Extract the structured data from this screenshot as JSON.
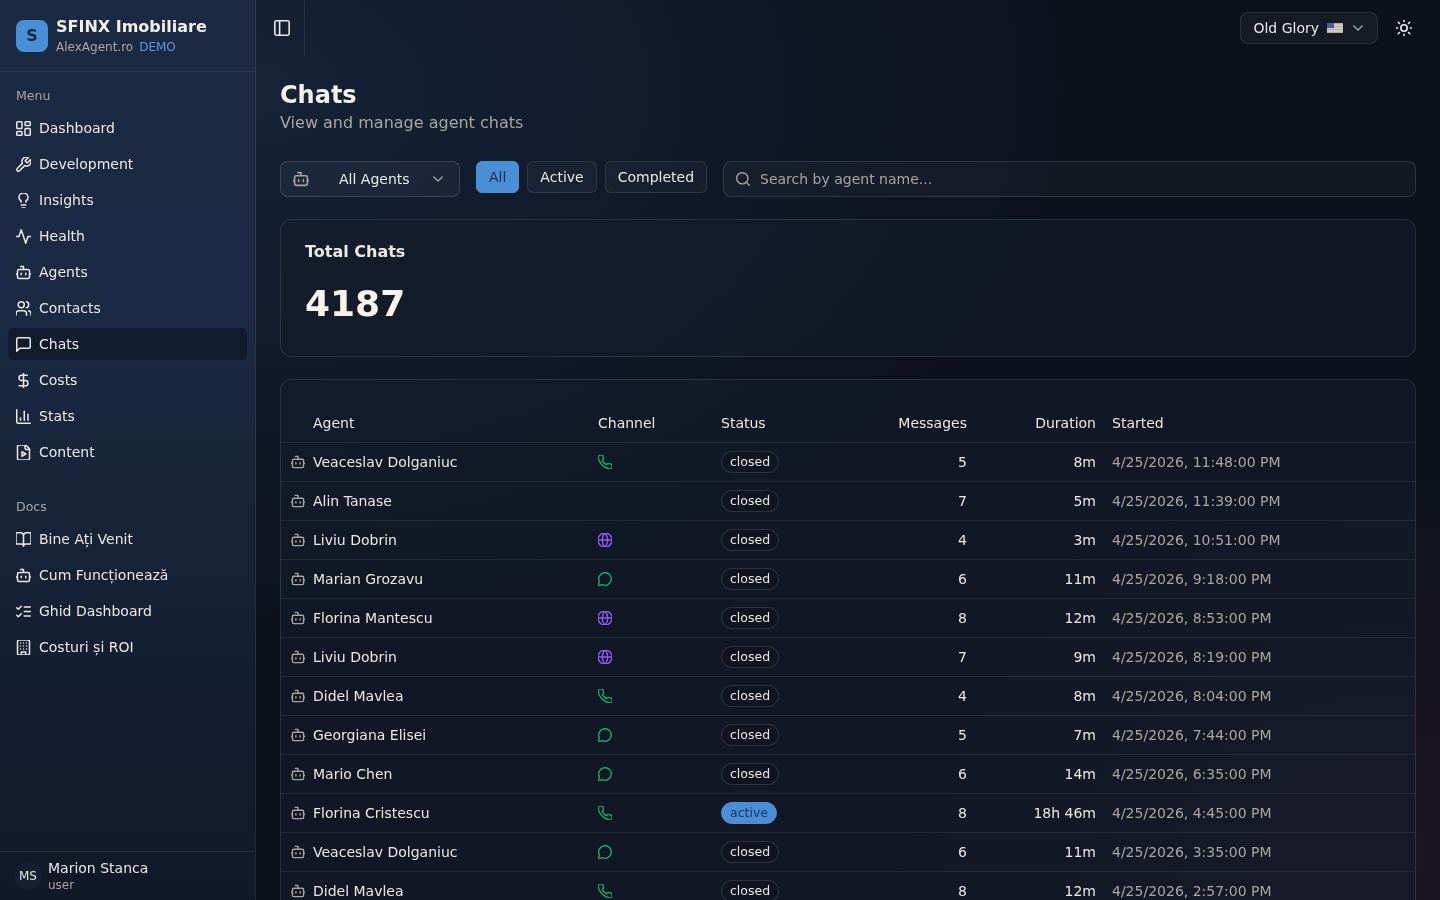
{
  "sidebar": {
    "brand": {
      "logo_letter": "S",
      "name": "SFINX Imobiliare",
      "site": "AlexAgent.ro",
      "badge": "DEMO"
    },
    "sections": [
      {
        "title": "Menu",
        "items": [
          {
            "label": "Dashboard",
            "selected": false
          },
          {
            "label": "Development",
            "selected": false
          },
          {
            "label": "Insights",
            "selected": false
          },
          {
            "label": "Health",
            "selected": false
          },
          {
            "label": "Agents",
            "selected": false
          },
          {
            "label": "Contacts",
            "selected": false
          },
          {
            "label": "Chats",
            "selected": true
          },
          {
            "label": "Costs",
            "selected": false
          },
          {
            "label": "Stats",
            "selected": false
          },
          {
            "label": "Content",
            "selected": false
          }
        ]
      },
      {
        "title": "Docs",
        "items": [
          {
            "label": "Bine Ați Venit",
            "selected": false
          },
          {
            "label": "Cum Funcționează",
            "selected": false
          },
          {
            "label": "Ghid Dashboard",
            "selected": false
          },
          {
            "label": "Costuri și ROI",
            "selected": false
          }
        ]
      }
    ],
    "user": {
      "initials": "MS",
      "name": "Marion Stanca",
      "role": "user"
    }
  },
  "topbar": {
    "theme_select": {
      "value": "Old Glory"
    }
  },
  "page": {
    "title": "Chats",
    "subtitle": "View and manage agent chats"
  },
  "filters": {
    "agent_select": {
      "value": "All Agents"
    },
    "status_tabs": [
      {
        "label": "All",
        "selected": true
      },
      {
        "label": "Active",
        "selected": false
      },
      {
        "label": "Completed",
        "selected": false
      }
    ],
    "search": {
      "placeholder": "Search by agent name..."
    }
  },
  "stats_card": {
    "title": "Total Chats",
    "value": "4187"
  },
  "table": {
    "columns": [
      "Agent",
      "Channel",
      "Status",
      "Messages",
      "Duration",
      "Started"
    ],
    "rows": [
      {
        "agent": "Veaceslav Dolganiuc",
        "channel": {
          "kind": "phone"
        },
        "status": "closed",
        "status_active": false,
        "messages": "5",
        "duration": "8m",
        "started": "4/25/2026, 11:48:00 PM"
      },
      {
        "agent": "Alin Tanase",
        "status": "closed",
        "status_active": false,
        "messages": "7",
        "duration": "5m",
        "started": "4/25/2026, 11:39:00 PM"
      },
      {
        "agent": "Liviu Dobrin",
        "channel": {
          "kind": "web"
        },
        "status": "closed",
        "status_active": false,
        "messages": "4",
        "duration": "3m",
        "started": "4/25/2026, 10:51:00 PM"
      },
      {
        "agent": "Marian Grozavu",
        "channel": {
          "kind": "chat"
        },
        "status": "closed",
        "status_active": false,
        "messages": "6",
        "duration": "11m",
        "started": "4/25/2026, 9:18:00 PM"
      },
      {
        "agent": "Florina Mantescu",
        "channel": {
          "kind": "web"
        },
        "status": "closed",
        "status_active": false,
        "messages": "8",
        "duration": "12m",
        "started": "4/25/2026, 8:53:00 PM"
      },
      {
        "agent": "Liviu Dobrin",
        "channel": {
          "kind": "web"
        },
        "status": "closed",
        "status_active": false,
        "messages": "7",
        "duration": "9m",
        "started": "4/25/2026, 8:19:00 PM"
      },
      {
        "agent": "Didel Mavlea",
        "channel": {
          "kind": "phone"
        },
        "status": "closed",
        "status_active": false,
        "messages": "4",
        "duration": "8m",
        "started": "4/25/2026, 8:04:00 PM"
      },
      {
        "agent": "Georgiana Elisei",
        "channel": {
          "kind": "chat"
        },
        "status": "closed",
        "status_active": false,
        "messages": "5",
        "duration": "7m",
        "started": "4/25/2026, 7:44:00 PM"
      },
      {
        "agent": "Mario Chen",
        "channel": {
          "kind": "chat"
        },
        "status": "closed",
        "status_active": false,
        "messages": "6",
        "duration": "14m",
        "started": "4/25/2026, 6:35:00 PM"
      },
      {
        "agent": "Florina Cristescu",
        "channel": {
          "kind": "phone"
        },
        "status": "active",
        "status_active": true,
        "messages": "8",
        "duration": "18h 46m",
        "started": "4/25/2026, 4:45:00 PM"
      },
      {
        "agent": "Veaceslav Dolganiuc",
        "channel": {
          "kind": "chat"
        },
        "status": "closed",
        "status_active": false,
        "messages": "6",
        "duration": "11m",
        "started": "4/25/2026, 3:35:00 PM"
      },
      {
        "agent": "Didel Mavlea",
        "channel": {
          "kind": "phone"
        },
        "status": "closed",
        "status_active": false,
        "messages": "8",
        "duration": "12m",
        "started": "4/25/2026, 2:57:00 PM"
      }
    ]
  }
}
